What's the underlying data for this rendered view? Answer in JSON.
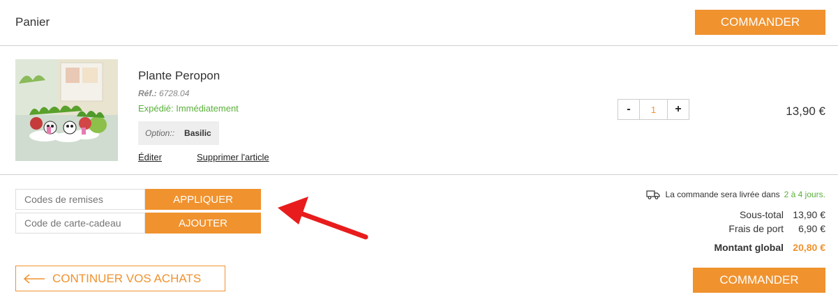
{
  "header": {
    "title": "Panier",
    "checkout_label": "COMMANDER"
  },
  "item": {
    "name": "Plante Peropon",
    "ref_label": "Réf.:",
    "ref_value": "6728.04",
    "shipping": "Expédié: Immédiatement",
    "option_label": "Option::",
    "option_value": "Basilic",
    "edit_label": "Éditer",
    "delete_label": "Supprimer l'article",
    "quantity": "1",
    "qty_minus": "-",
    "qty_plus": "+",
    "price": "13,90 €"
  },
  "codes": {
    "discount_placeholder": "Codes de remises",
    "discount_button": "APPLIQUER",
    "gift_placeholder": "Code de carte-cadeau",
    "gift_button": "AJOUTER"
  },
  "continue_label": "CONTINUER VOS ACHATS",
  "summary": {
    "delivery_text": "La commande sera livrée dans",
    "delivery_days": "2 à 4 jours.",
    "subtotal_label": "Sous-total",
    "subtotal_value": "13,90 €",
    "shipping_label": "Frais de port",
    "shipping_value": "6,90 €",
    "total_label": "Montant global",
    "total_value": "20,80 €",
    "checkout_label": "COMMANDER"
  },
  "colors": {
    "accent": "#f0922e",
    "green": "#5aaf3a",
    "annotation_arrow": "#e81c1c"
  },
  "icons": {
    "delivery": "truck-icon",
    "back": "arrow-left-icon",
    "annotation": "red-arrow-icon"
  }
}
